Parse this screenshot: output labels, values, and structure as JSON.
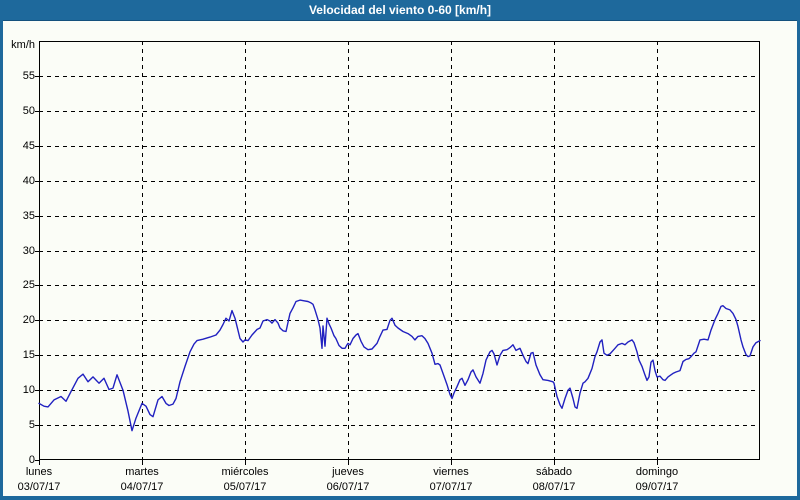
{
  "window": {
    "title": "Velocidad del viento 0-60 [km/h]",
    "title_bg": "#1e699c",
    "title_color": "#ffffff",
    "border_color": "#1e699c",
    "background": "#fbfdf7"
  },
  "chart_data": {
    "type": "line",
    "title": "Velocidad del viento 0-60 [km/h]",
    "unit_label": "km/h",
    "ylabel": "km/h",
    "xlabel": "",
    "ylim": [
      0,
      60
    ],
    "yticks": [
      0,
      5,
      10,
      15,
      20,
      25,
      30,
      35,
      40,
      45,
      50,
      55
    ],
    "grid": "dashed",
    "legend": "none",
    "line_color": "#2121c0",
    "grid_color": "#000000",
    "x_days": [
      {
        "name": "lunes",
        "date": "03/07/17"
      },
      {
        "name": "martes",
        "date": "04/07/17"
      },
      {
        "name": "miércoles",
        "date": "05/07/17"
      },
      {
        "name": "jueves",
        "date": "06/07/17"
      },
      {
        "name": "viernes",
        "date": "07/07/17"
      },
      {
        "name": "sábado",
        "date": "08/07/17"
      },
      {
        "name": "domingo",
        "date": "09/07/17"
      }
    ],
    "series": [
      {
        "name": "Velocidad del viento",
        "x_unit": "days_since_start",
        "y_unit": "km/h",
        "points": [
          [
            0.0,
            8.1
          ],
          [
            0.049,
            7.7
          ],
          [
            0.087,
            7.6
          ],
          [
            0.146,
            8.6
          ],
          [
            0.214,
            9.1
          ],
          [
            0.262,
            8.4
          ],
          [
            0.311,
            9.8
          ],
          [
            0.379,
            11.7
          ],
          [
            0.427,
            12.3
          ],
          [
            0.476,
            11.2
          ],
          [
            0.524,
            11.9
          ],
          [
            0.583,
            11.0
          ],
          [
            0.631,
            11.7
          ],
          [
            0.68,
            10.1
          ],
          [
            0.718,
            10.3
          ],
          [
            0.757,
            12.2
          ],
          [
            0.816,
            10.0
          ],
          [
            0.864,
            7.0
          ],
          [
            0.903,
            4.2
          ],
          [
            0.942,
            6.0
          ],
          [
            1.0,
            8.1
          ],
          [
            1.039,
            7.7
          ],
          [
            1.078,
            6.5
          ],
          [
            1.107,
            6.2
          ],
          [
            1.155,
            8.6
          ],
          [
            1.194,
            9.1
          ],
          [
            1.233,
            8.1
          ],
          [
            1.262,
            7.8
          ],
          [
            1.301,
            8.0
          ],
          [
            1.33,
            8.8
          ],
          [
            1.369,
            11.2
          ],
          [
            1.417,
            13.4
          ],
          [
            1.466,
            15.5
          ],
          [
            1.505,
            16.6
          ],
          [
            1.534,
            17.1
          ],
          [
            1.592,
            17.3
          ],
          [
            1.66,
            17.6
          ],
          [
            1.718,
            17.9
          ],
          [
            1.757,
            18.6
          ],
          [
            1.786,
            19.4
          ],
          [
            1.816,
            20.3
          ],
          [
            1.845,
            19.9
          ],
          [
            1.874,
            21.4
          ],
          [
            1.903,
            20.3
          ],
          [
            1.951,
            17.4
          ],
          [
            1.981,
            16.9
          ],
          [
            2.0,
            17.2
          ],
          [
            2.029,
            17.1
          ],
          [
            2.068,
            17.9
          ],
          [
            2.117,
            18.7
          ],
          [
            2.146,
            18.9
          ],
          [
            2.175,
            19.9
          ],
          [
            2.214,
            20.1
          ],
          [
            2.243,
            19.9
          ],
          [
            2.262,
            19.6
          ],
          [
            2.291,
            20.1
          ],
          [
            2.32,
            19.6
          ],
          [
            2.34,
            18.9
          ],
          [
            2.369,
            18.5
          ],
          [
            2.398,
            18.4
          ],
          [
            2.437,
            21.0
          ],
          [
            2.466,
            21.8
          ],
          [
            2.495,
            22.7
          ],
          [
            2.534,
            22.9
          ],
          [
            2.573,
            22.8
          ],
          [
            2.612,
            22.7
          ],
          [
            2.641,
            22.5
          ],
          [
            2.66,
            22.3
          ],
          [
            2.68,
            21.5
          ],
          [
            2.709,
            20.1
          ],
          [
            2.728,
            18.9
          ],
          [
            2.748,
            16.0
          ],
          [
            2.757,
            19.2
          ],
          [
            2.777,
            16.3
          ],
          [
            2.796,
            20.3
          ],
          [
            2.816,
            19.5
          ],
          [
            2.835,
            18.9
          ],
          [
            2.864,
            17.8
          ],
          [
            2.883,
            17.4
          ],
          [
            2.913,
            16.4
          ],
          [
            2.942,
            16.0
          ],
          [
            2.971,
            16.0
          ],
          [
            2.99,
            16.5
          ],
          [
            3.0,
            16.7
          ],
          [
            3.019,
            16.5
          ],
          [
            3.049,
            17.4
          ],
          [
            3.078,
            17.9
          ],
          [
            3.097,
            18.1
          ],
          [
            3.126,
            17.0
          ],
          [
            3.155,
            16.2
          ],
          [
            3.194,
            15.8
          ],
          [
            3.233,
            15.9
          ],
          [
            3.282,
            16.7
          ],
          [
            3.311,
            17.7
          ],
          [
            3.34,
            18.6
          ],
          [
            3.379,
            18.7
          ],
          [
            3.408,
            20.0
          ],
          [
            3.427,
            20.3
          ],
          [
            3.456,
            19.3
          ],
          [
            3.485,
            18.9
          ],
          [
            3.534,
            18.4
          ],
          [
            3.583,
            18.1
          ],
          [
            3.621,
            17.7
          ],
          [
            3.65,
            17.2
          ],
          [
            3.68,
            17.7
          ],
          [
            3.718,
            17.8
          ],
          [
            3.747,
            17.4
          ],
          [
            3.777,
            16.7
          ],
          [
            3.816,
            15.3
          ],
          [
            3.845,
            13.7
          ],
          [
            3.874,
            13.8
          ],
          [
            3.893,
            13.6
          ],
          [
            3.922,
            12.4
          ],
          [
            3.961,
            10.8
          ],
          [
            3.99,
            9.4
          ],
          [
            4.01,
            8.8
          ],
          [
            4.029,
            9.6
          ],
          [
            4.058,
            10.5
          ],
          [
            4.087,
            11.5
          ],
          [
            4.107,
            11.7
          ],
          [
            4.136,
            10.7
          ],
          [
            4.165,
            11.5
          ],
          [
            4.194,
            12.6
          ],
          [
            4.214,
            12.9
          ],
          [
            4.243,
            11.9
          ],
          [
            4.282,
            11.0
          ],
          [
            4.311,
            12.4
          ],
          [
            4.34,
            14.3
          ],
          [
            4.379,
            15.5
          ],
          [
            4.398,
            15.7
          ],
          [
            4.417,
            15.2
          ],
          [
            4.447,
            13.6
          ],
          [
            4.476,
            15.0
          ],
          [
            4.505,
            15.7
          ],
          [
            4.544,
            15.8
          ],
          [
            4.573,
            16.1
          ],
          [
            4.602,
            16.5
          ],
          [
            4.631,
            15.7
          ],
          [
            4.67,
            16.0
          ],
          [
            4.699,
            15.0
          ],
          [
            4.728,
            14.1
          ],
          [
            4.748,
            13.8
          ],
          [
            4.777,
            15.3
          ],
          [
            4.796,
            15.4
          ],
          [
            4.825,
            13.6
          ],
          [
            4.864,
            12.2
          ],
          [
            4.893,
            11.5
          ],
          [
            4.942,
            11.4
          ],
          [
            4.99,
            11.2
          ],
          [
            5.0,
            11.0
          ],
          [
            5.029,
            9.1
          ],
          [
            5.058,
            7.9
          ],
          [
            5.078,
            7.4
          ],
          [
            5.107,
            8.8
          ],
          [
            5.136,
            10.0
          ],
          [
            5.155,
            10.3
          ],
          [
            5.184,
            8.8
          ],
          [
            5.204,
            7.6
          ],
          [
            5.223,
            7.4
          ],
          [
            5.252,
            9.6
          ],
          [
            5.282,
            11.0
          ],
          [
            5.301,
            11.2
          ],
          [
            5.33,
            11.7
          ],
          [
            5.369,
            13.1
          ],
          [
            5.398,
            14.8
          ],
          [
            5.417,
            15.5
          ],
          [
            5.447,
            16.9
          ],
          [
            5.466,
            17.2
          ],
          [
            5.485,
            15.3
          ],
          [
            5.515,
            15.0
          ],
          [
            5.544,
            15.2
          ],
          [
            5.592,
            16.0
          ],
          [
            5.621,
            16.5
          ],
          [
            5.66,
            16.7
          ],
          [
            5.689,
            16.5
          ],
          [
            5.718,
            16.9
          ],
          [
            5.757,
            17.2
          ],
          [
            5.777,
            16.8
          ],
          [
            5.806,
            15.5
          ],
          [
            5.825,
            14.3
          ],
          [
            5.854,
            13.4
          ],
          [
            5.883,
            12.2
          ],
          [
            5.903,
            11.4
          ],
          [
            5.922,
            11.9
          ],
          [
            5.942,
            14.0
          ],
          [
            5.961,
            14.3
          ],
          [
            5.981,
            12.8
          ],
          [
            6.0,
            11.9
          ],
          [
            6.029,
            12.0
          ],
          [
            6.058,
            11.5
          ],
          [
            6.078,
            11.4
          ],
          [
            6.107,
            11.9
          ],
          [
            6.136,
            12.2
          ],
          [
            6.155,
            12.4
          ],
          [
            6.184,
            12.6
          ],
          [
            6.223,
            12.8
          ],
          [
            6.252,
            14.1
          ],
          [
            6.282,
            14.4
          ],
          [
            6.311,
            14.5
          ],
          [
            6.33,
            14.8
          ],
          [
            6.359,
            15.3
          ],
          [
            6.379,
            15.5
          ],
          [
            6.417,
            17.2
          ],
          [
            6.456,
            17.3
          ],
          [
            6.495,
            17.2
          ],
          [
            6.524,
            18.6
          ],
          [
            6.563,
            20.1
          ],
          [
            6.592,
            21.0
          ],
          [
            6.621,
            22.0
          ],
          [
            6.641,
            22.1
          ],
          [
            6.67,
            21.7
          ],
          [
            6.709,
            21.5
          ],
          [
            6.738,
            21.0
          ],
          [
            6.767,
            20.1
          ],
          [
            6.786,
            19.1
          ],
          [
            6.816,
            17.2
          ],
          [
            6.835,
            16.2
          ],
          [
            6.864,
            15.1
          ],
          [
            6.884,
            14.8
          ],
          [
            6.903,
            14.9
          ],
          [
            6.932,
            16.2
          ],
          [
            6.961,
            16.8
          ],
          [
            7.0,
            17.1
          ]
        ]
      }
    ]
  }
}
